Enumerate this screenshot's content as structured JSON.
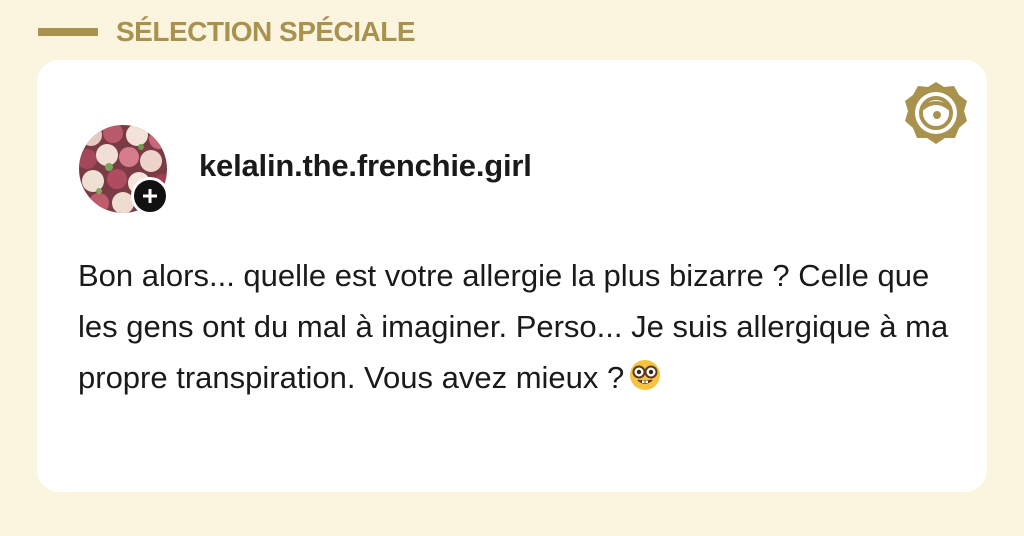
{
  "section": {
    "title": "SÉLECTION SPÉCIALE"
  },
  "post": {
    "username": "kelalin.the.frenchie.girl",
    "text": "Bon alors... quelle est votre allergie la plus bizarre ? Celle que les gens ont du mal à imaginer. Perso... Je suis allergique à ma propre transpiration. Vous avez mieux ?",
    "emoji": "nerd-face-emoji"
  },
  "badge": {
    "icon": "community-badge-icon"
  },
  "colors": {
    "background": "#fbf5df",
    "accent": "#a8924e",
    "card": "#ffffff",
    "text": "#1a1a1a"
  }
}
